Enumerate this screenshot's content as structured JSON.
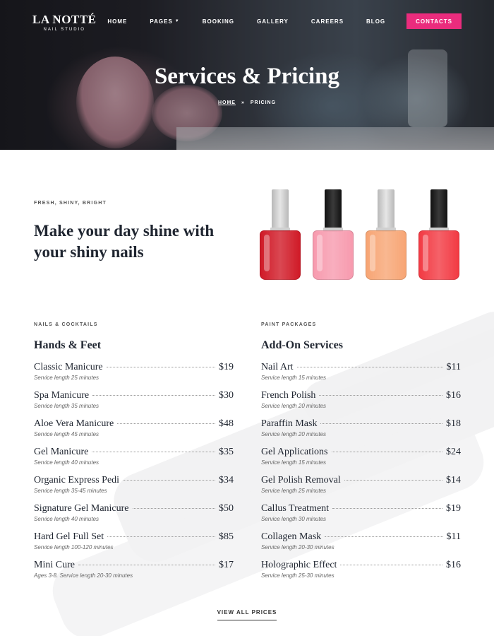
{
  "brand": {
    "name": "LA NOTTÉ",
    "tagline": "NAIL STUDIO"
  },
  "nav": {
    "items": [
      {
        "label": "HOME"
      },
      {
        "label": "PAGES"
      },
      {
        "label": "BOOKING"
      },
      {
        "label": "GALLERY"
      },
      {
        "label": "CAREERS"
      },
      {
        "label": "BLOG"
      }
    ],
    "cta": "CONTACTS"
  },
  "hero": {
    "title": "Services & Pricing",
    "breadcrumb": {
      "home": "HOME",
      "separator": "»",
      "current": "PRICING"
    }
  },
  "intro": {
    "eyebrow": "FRESH, SHINY, BRIGHT",
    "heading": "Make your day shine with your shiny nails"
  },
  "bottles": [
    {
      "cap": "#b8b8b8",
      "polish": "#d01a27"
    },
    {
      "cap": "#111111",
      "polish": "#f79aae"
    },
    {
      "cap": "#b8b8b8",
      "polish": "#f7a574"
    },
    {
      "cap": "#111111",
      "polish": "#f23a43"
    }
  ],
  "left_column": {
    "eyebrow": "NAILS & COCKTAILS",
    "title": "Hands & Feet",
    "items": [
      {
        "name": "Classic Manicure",
        "price": "$19",
        "desc": "Service length 25 minutes"
      },
      {
        "name": "Spa Manicure",
        "price": "$30",
        "desc": "Service length 35 minutes"
      },
      {
        "name": "Aloe Vera Manicure",
        "price": "$48",
        "desc": "Service length 45 minutes"
      },
      {
        "name": "Gel Manicure",
        "price": "$35",
        "desc": "Service length 40 minutes"
      },
      {
        "name": "Organic Express Pedi",
        "price": "$34",
        "desc": "Service length 35-45 minutes"
      },
      {
        "name": "Signature Gel Manicure",
        "price": "$50",
        "desc": "Service length 40 minutes"
      },
      {
        "name": "Hard Gel Full Set",
        "price": "$85",
        "desc": "Service length 100-120 minutes"
      },
      {
        "name": "Mini Cure",
        "price": "$17",
        "desc": "Ages 3-8. Service length 20-30 minutes"
      }
    ]
  },
  "right_column": {
    "eyebrow": "PAINT PACKAGES",
    "title": "Add-On Services",
    "items": [
      {
        "name": "Nail Art",
        "price": "$11",
        "desc": "Service length 15 minutes"
      },
      {
        "name": "French Polish",
        "price": "$16",
        "desc": "Service length 20 minutes"
      },
      {
        "name": "Paraffin Mask",
        "price": "$18",
        "desc": "Service length 20 minutes"
      },
      {
        "name": "Gel Applications",
        "price": "$24",
        "desc": "Service length 15 minutes"
      },
      {
        "name": "Gel Polish Removal",
        "price": "$14",
        "desc": "Service length 25 minutes"
      },
      {
        "name": "Callus Treatment",
        "price": "$19",
        "desc": "Service length 30 minutes"
      },
      {
        "name": "Collagen Mask",
        "price": "$11",
        "desc": "Service length 20-30 minutes"
      },
      {
        "name": "Holographic Effect",
        "price": "$16",
        "desc": "Service length 25-30 minutes"
      }
    ]
  },
  "view_all": "VIEW ALL PRICES",
  "colors": {
    "accent": "#ea2c7d",
    "heading": "#1f2530"
  }
}
